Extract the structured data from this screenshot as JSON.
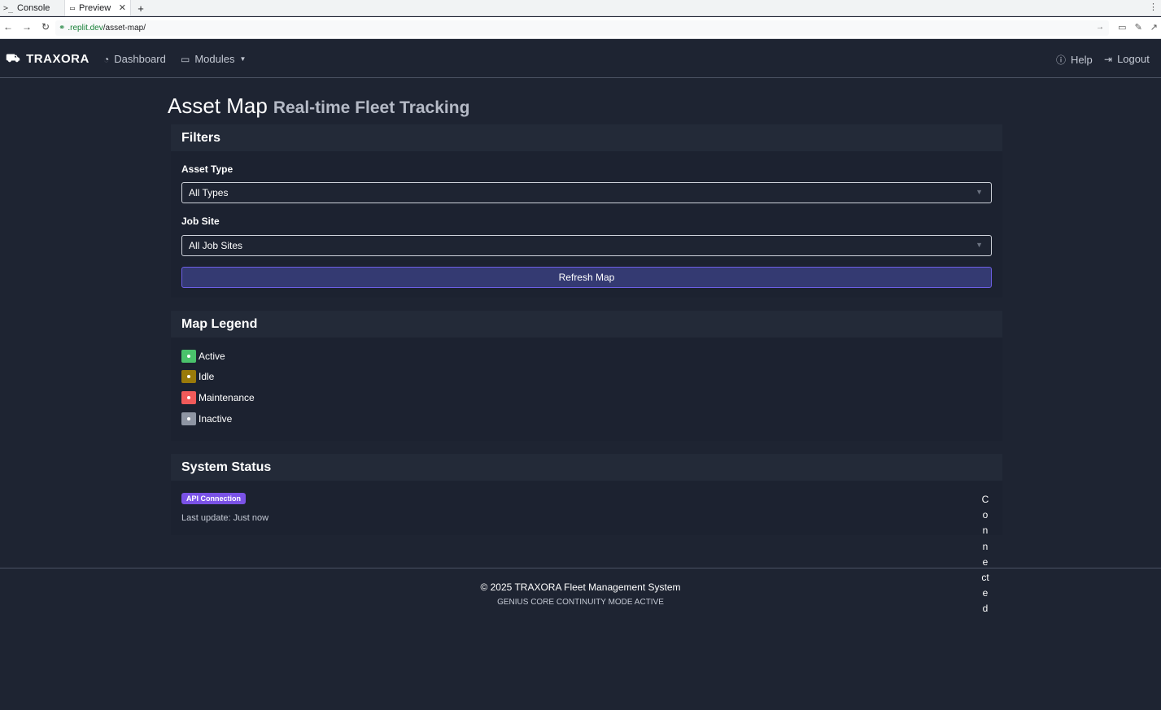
{
  "browser": {
    "tabs": [
      {
        "label": "Console",
        "icon": "terminal-icon"
      },
      {
        "label": "Preview",
        "icon": "monitor-icon"
      }
    ],
    "url_host": ".replit.dev",
    "url_path": "/asset-map/"
  },
  "navbar": {
    "brand": "TRAXORA",
    "links": {
      "dashboard": "Dashboard",
      "modules": "Modules",
      "help": "Help",
      "logout": "Logout"
    }
  },
  "page": {
    "title": "Asset Map",
    "subtitle": "Real-time Fleet Tracking"
  },
  "filters": {
    "header": "Filters",
    "asset_type_label": "Asset Type",
    "asset_type_value": "All Types",
    "job_site_label": "Job Site",
    "job_site_value": "All Job Sites",
    "refresh_label": "Refresh Map"
  },
  "legend": {
    "header": "Map Legend",
    "items": [
      {
        "label": "Active",
        "color": "#4ac26b"
      },
      {
        "label": "Idle",
        "color": "#9a7a0a"
      },
      {
        "label": "Maintenance",
        "color": "#f05a5a"
      },
      {
        "label": "Inactive",
        "color": "#8e95a3"
      }
    ]
  },
  "status": {
    "header": "System Status",
    "badge": "API Connection",
    "last_update": "Last update: Just now",
    "connection_state": "Connected"
  },
  "footer": {
    "copyright": "© 2025 TRAXORA Fleet Management System",
    "mode": "GENIUS CORE CONTINUITY MODE ACTIVE"
  },
  "colors": {
    "background": "#1e2432",
    "card": "#1c2230",
    "accent": "#6d5fe6",
    "badge": "#7a52e6"
  }
}
